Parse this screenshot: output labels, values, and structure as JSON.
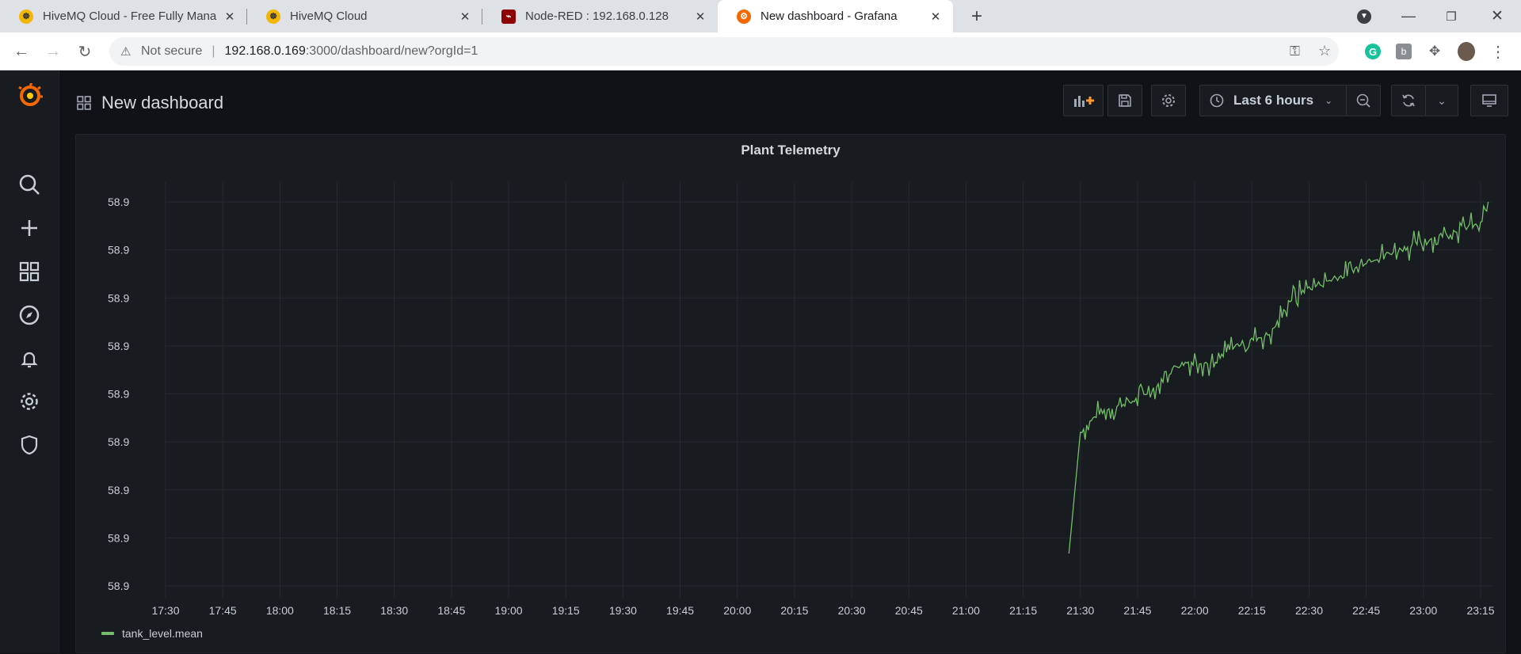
{
  "tabs": [
    {
      "title": "HiveMQ Cloud - Free Fully Mana",
      "icon": "hivemq-icon"
    },
    {
      "title": "HiveMQ Cloud",
      "icon": "hivemq-icon"
    },
    {
      "title": "Node-RED : 192.168.0.128",
      "icon": "nodered-icon"
    },
    {
      "title": "New dashboard - Grafana",
      "icon": "grafana-icon"
    }
  ],
  "address": {
    "security": "Not secure",
    "host": "192.168.0.169",
    "path": ":3000/dashboard/new?orgId=1"
  },
  "dashboard": {
    "title": "New dashboard",
    "time_range": "Last 6 hours"
  },
  "panel": {
    "title": "Plant Telemetry"
  },
  "colors": {
    "series": "#73bf69",
    "background": "#111217",
    "panel": "#181b1f"
  },
  "chart_data": {
    "type": "line",
    "title": "Plant Telemetry",
    "y_ticks": [
      "58.9",
      "58.9",
      "58.9",
      "58.9",
      "58.9",
      "58.9",
      "58.9",
      "58.9",
      "58.9"
    ],
    "x_ticks": [
      "17:30",
      "17:45",
      "18:00",
      "18:15",
      "18:30",
      "18:45",
      "19:00",
      "19:15",
      "19:30",
      "19:45",
      "20:00",
      "20:15",
      "20:30",
      "20:45",
      "21:00",
      "21:15",
      "21:30",
      "21:45",
      "22:00",
      "22:15",
      "22:30",
      "22:45",
      "23:00",
      "23:15"
    ],
    "grid": true,
    "legend": "bottom-left",
    "series": [
      {
        "name": "tank_level.mean",
        "color": "#73bf69",
        "x": [
          "21:27",
          "21:30",
          "21:35",
          "21:40",
          "21:45",
          "21:50",
          "21:55",
          "22:00",
          "22:05",
          "22:10",
          "22:15",
          "22:20",
          "22:25",
          "22:30",
          "22:35",
          "22:40",
          "22:45",
          "22:50",
          "22:55",
          "23:00",
          "23:05",
          "23:10",
          "23:15",
          "23:17"
        ],
        "y_level": [
          0.05,
          0.42,
          0.48,
          0.5,
          0.52,
          0.56,
          0.62,
          0.64,
          0.62,
          0.68,
          0.7,
          0.72,
          0.82,
          0.86,
          0.88,
          0.9,
          0.94,
          0.96,
          0.98,
          1.0,
          1.02,
          1.04,
          1.05,
          1.12
        ]
      }
    ]
  }
}
